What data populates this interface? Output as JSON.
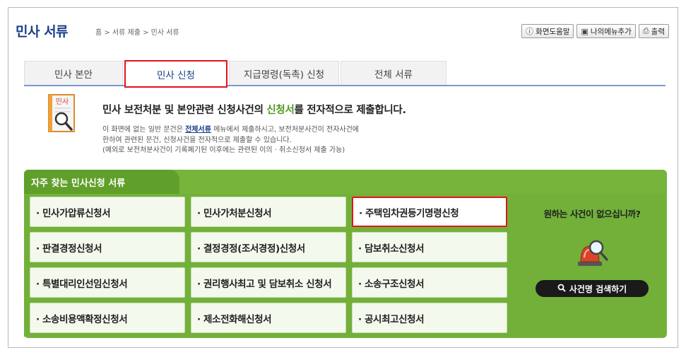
{
  "header": {
    "title": "민사 서류",
    "breadcrumb": "홈 > 서류 제출 > 민사 서류",
    "buttons": {
      "help": "화면도움말",
      "add_menu": "나의메뉴추가",
      "print": "출력"
    }
  },
  "tabs": [
    {
      "label": "민사 본안"
    },
    {
      "label": "민사 신청"
    },
    {
      "label": "지급명령(독촉) 신청"
    },
    {
      "label": "전체 서류"
    }
  ],
  "intro": {
    "icon_label": "민사",
    "headline_a": "민사 보전처분 및 본안관련 신청사건의 ",
    "headline_b": "신청서",
    "headline_c": "를 전자적으로 제출합니다.",
    "line1_a": "이 화면에 없는 일반 문건은 ",
    "line1_link": "전체서류",
    "line1_b": " 메뉴에서 제출하시고, 보전처분사건이 전자사건에",
    "line2": "한하여 관련된 문건, 신청사건을 전자적으로 제출할 수 있습니다.",
    "line3": "(예외로 보전처분사건이 기록폐기된 이후에는 관련된 이의 · 취소신청서 제출 가능)"
  },
  "panel": {
    "title": "자주 찾는 민사신청 서류",
    "items": [
      "· 민사가압류신청서",
      "· 민사가처분신청서",
      "· 주택임차권등기명령신청",
      "· 판결경정신청서",
      "· 결정경정(조서경정)신청서",
      "· 담보취소신청서",
      "· 특별대리인선임신청서",
      "· 권리행사최고 및 담보취소 신청서",
      "· 소송구조신청서",
      "· 소송비용액확정신청서",
      "· 제소전화해신청서",
      "· 공시최고신청서"
    ],
    "side_question": "원하는 사건이 없으십니까?",
    "search_button": "사건명 검색하기"
  },
  "colors": {
    "title_blue": "#1a3f8a",
    "panel_green": "#76b43c",
    "highlight_red": "#e3141b"
  },
  "icons": [
    "info-icon",
    "bookmark-icon",
    "printer-icon",
    "document-magnifier-icon",
    "siren-magnifier-icon",
    "search-icon"
  ]
}
